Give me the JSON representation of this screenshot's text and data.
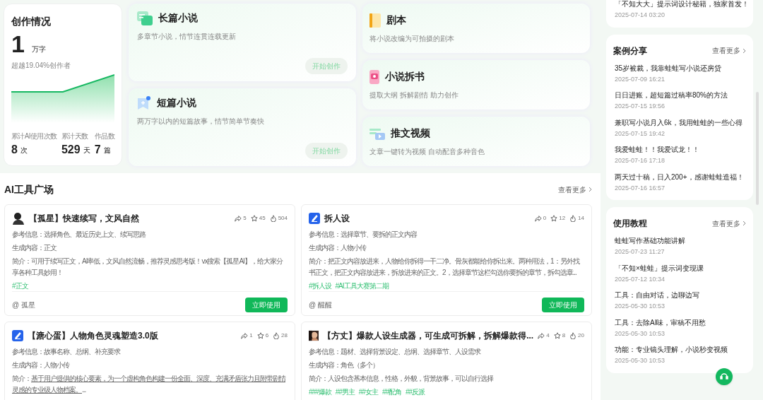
{
  "stats": {
    "title": "创作情况",
    "value": "1",
    "unit": "万字",
    "rank": "超越19.04%创作者",
    "metrics": [
      {
        "label": "累计AI使用次数",
        "value": "8",
        "unit": "次"
      },
      {
        "label": "累计天数",
        "value": "529",
        "unit": "天"
      },
      {
        "label": "作品数",
        "value": "7",
        "unit": "篇"
      }
    ]
  },
  "modes_large": [
    {
      "kind": "long",
      "title": "长篇小说",
      "desc": "多章节小说，情节连贯连载更新",
      "button": "开始创作"
    },
    {
      "kind": "short",
      "title": "短篇小说",
      "desc": "两万字以内的短篇故事，情节简单节奏快",
      "button": "开始创作"
    }
  ],
  "modes_small": [
    {
      "kind": "script",
      "title": "剧本",
      "desc": "将小说改编为可拍摄的剧本"
    },
    {
      "kind": "split",
      "title": "小说拆书",
      "desc": "提取大纲 拆解剧情 助力创作"
    },
    {
      "kind": "video",
      "title": "推文视频",
      "desc": "文章一键转为视频 自动配音多种音色"
    }
  ],
  "tools": {
    "title": "AI工具广场",
    "more": "查看更多",
    "cards": [
      {
        "kind": "person",
        "title": "【孤星】快速续写，文风自然",
        "shares": "5",
        "stars": "45",
        "uses": "504",
        "ref_label": "参考信息：",
        "ref": "选择角色、最近历史上文、续写思路",
        "out_label": "生成内容：",
        "out": "正文",
        "intro_label": "简介：",
        "intro": "可用于续写正文，AI率低，文风自然流畅，推荐灵感思考版！vx搜索【孤星AI】，给大家分享各种工具妙用！",
        "underlined": false,
        "tags": [
          "#正文"
        ],
        "author": "@ 孤星",
        "button": "立即使用"
      },
      {
        "kind": "pen",
        "title": "拆人设",
        "shares": "0",
        "stars": "12",
        "uses": "14",
        "ref_label": "参考信息：",
        "ref": "选择章节、要拆的正文内容",
        "out_label": "生成内容：",
        "out": "人物小传",
        "intro_label": "简介：",
        "intro": "把正文内容放进来，人物给你拆得一干二净。骨灰都能给你拆出来。两种用法，1：另外找书正文，把正文内容放进来，拆放进来的正文。2，选择章节这栏勾选你要拆的章节，拆勾选章...",
        "underlined": false,
        "tags": [
          "#拆人设",
          "#AI工具大赛第二期"
        ],
        "author": "@ 醒醒",
        "button": "立即使用"
      },
      {
        "kind": "pen",
        "title": "【溏心蛋】人物角色灵魂塑造3.0版",
        "shares": "1",
        "stars": "6",
        "uses": "28",
        "ref_label": "参考信息：",
        "ref": "故事名称、总纲、补充要求",
        "out_label": "生成内容：",
        "out": "人物小传",
        "intro_label": "简介：",
        "intro": "基于用户提供的核心要素，为一个虚构角色构建一份全面、深度、充满矛盾张力且附带剧情灵感的专业级人物档案。",
        "intro_suffix": "...",
        "underlined": true
      },
      {
        "title": "【方丈】爆款人设生成器，可生成可拆解，拆解爆款得...",
        "shares": "4",
        "stars": "8",
        "uses": "20",
        "ref_label": "参考信息：",
        "ref": "题材、选择背景设定、总纲、选择章节、人设需求",
        "out_label": "生成内容：",
        "out": "角色（多个）",
        "intro_label": "简介：",
        "intro": "人设包含基本信息，性格，外貌，背景故事，可以自行选择",
        "underlined": false,
        "tags": [
          "###爆款",
          "##男主",
          "##女主",
          "##配角",
          "##反派"
        ]
      }
    ]
  },
  "sidebar": [
    {
      "items": [
        {
          "title": "「不知大大」提示词设计秘籍，独家首发！",
          "date": "2025-07-14 03:20"
        }
      ]
    },
    {
      "title": "案例分享",
      "more": "查看更多",
      "items": [
        {
          "title": "35岁被裁，我靠蛙蛙写小说还房贷",
          "date": "2025-07-09 16:21"
        },
        {
          "title": "日日进账，超短篇过稿率80%的方法",
          "date": "2025-07-15 19:56"
        },
        {
          "title": "兼职写小说月入6k，我用蛙蛙的一些心得",
          "date": "2025-07-15 19:42"
        },
        {
          "title": "我爱蛙蛙！！我爱试龙！！",
          "date": "2025-07-16 17:18"
        },
        {
          "title": "两天过十稿，日入200+，感谢蛙蛙造福！",
          "date": "2025-07-16 16:57"
        }
      ]
    },
    {
      "title": "使用教程",
      "more": "查看更多",
      "items": [
        {
          "title": "蛙蛙写作基础功能讲解",
          "date": "2025-07-23 11:27"
        },
        {
          "title": "「不知×蛙蛙」提示词变现课",
          "date": "2025-07-12 10:34"
        },
        {
          "title": "工具：自由对话，边聊边写",
          "date": "2025-05-30 10:53"
        },
        {
          "title": "工具：去除AI味，审稿不用愁",
          "date": "2025-05-30 10:53"
        },
        {
          "title": "功能：专业镜头理解，小说秒变视频",
          "date": "2025-05-30 10:53"
        }
      ]
    }
  ]
}
